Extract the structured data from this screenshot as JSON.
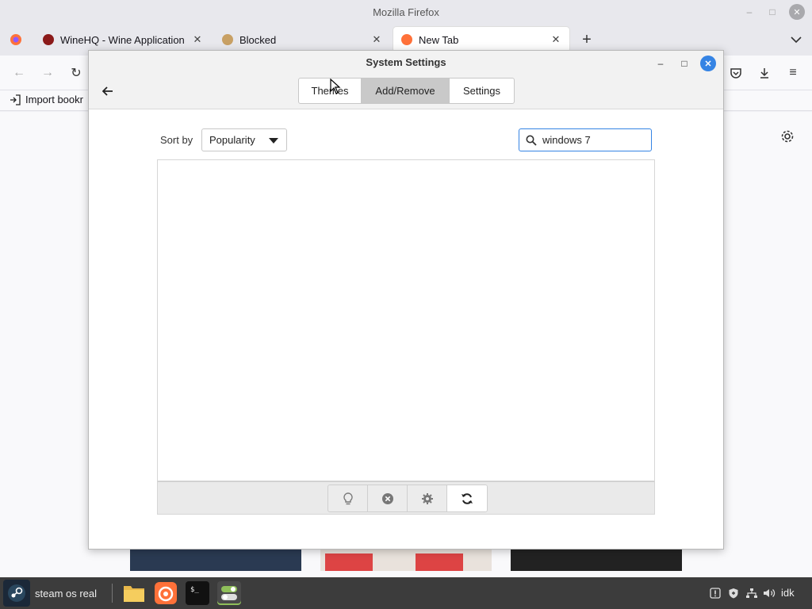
{
  "firefox": {
    "window_title": "Mozilla Firefox",
    "tabs": [
      {
        "label": "WineHQ - Wine Application",
        "favicon_color": "#8b1a1a"
      },
      {
        "label": "Blocked",
        "favicon_color": "#c8a064"
      },
      {
        "label": "New Tab",
        "favicon_color": "#ff7139"
      }
    ],
    "bookmarks_import_label": "Import bookr",
    "accent_color": "#ff7139"
  },
  "dialog": {
    "title": "System Settings",
    "tabs": [
      {
        "label": "Themes",
        "active": false
      },
      {
        "label": "Add/Remove",
        "active": true
      },
      {
        "label": "Settings",
        "active": false
      }
    ],
    "sort_label": "Sort by",
    "sort_value": "Popularity",
    "search_value": "windows 7",
    "toolbar_icons": [
      "lightbulb-icon",
      "close-circle-icon",
      "gear-icon",
      "refresh-icon"
    ],
    "accent_color": "#3584e4"
  },
  "taskbar": {
    "menu_label": "steam os real",
    "launchers": [
      "files-icon",
      "firefox-icon",
      "terminal-icon",
      "system-settings-icon"
    ],
    "tray_user": "idk"
  }
}
